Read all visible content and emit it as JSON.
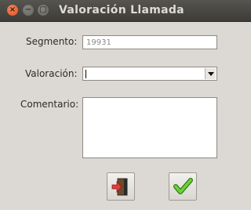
{
  "window": {
    "title": "Valoración Llamada",
    "controls": {
      "close": "×",
      "minimize": "−",
      "maximize": "□"
    }
  },
  "form": {
    "segmento_label": "Segmento:",
    "segmento_value": "19931",
    "valoracion_label": "Valoración:",
    "valoracion_value": "",
    "comentario_label": "Comentario:",
    "comentario_value": ""
  },
  "buttons": {
    "exit_icon": "exit-door-icon",
    "accept_icon": "checkmark-icon"
  },
  "colors": {
    "window_bg": "#dcd9d4",
    "titlebar": "#3d3c38",
    "close_button": "#e1501f",
    "exit_arrow": "#e23c3c",
    "checkmark": "#3fae1f"
  }
}
